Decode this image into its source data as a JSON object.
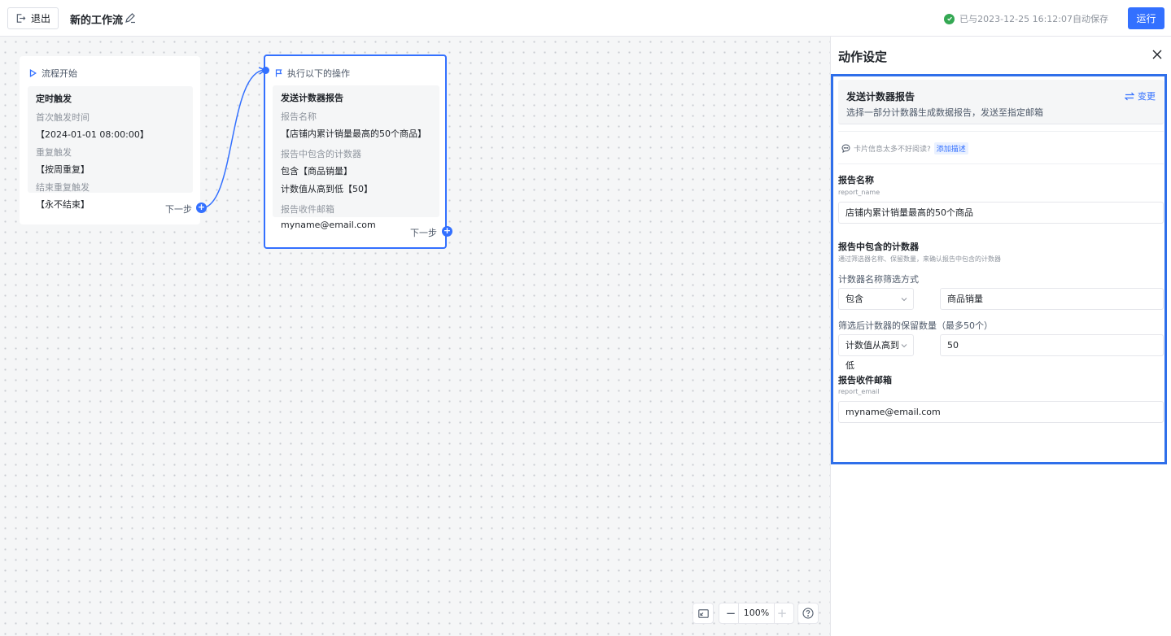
{
  "topbar": {
    "exit_label": "退出",
    "workflow_title": "新的工作流",
    "save_status": "已与2023-12-25 16:12:07自动保存",
    "run_label": "运行"
  },
  "nodes": {
    "start": {
      "header": "流程开始",
      "trigger_title": "定时触发",
      "first_time_label": "首次触发时间",
      "first_time_value": "【2024-01-01 08:00:00】",
      "repeat_label": "重复触发",
      "repeat_value": "【按周重复】",
      "end_label": "结束重复触发",
      "end_value": "【永不结束】",
      "next_label": "下一步"
    },
    "action": {
      "header": "执行以下的操作",
      "title": "发送计数器报告",
      "report_name_label": "报告名称",
      "report_name_value": "【店铺内累计销量最高的50个商品】",
      "counters_label": "报告中包含的计数器",
      "counters_value_1": "包含【商品销量】",
      "counters_value_2": "计数值从高到低【50】",
      "email_label": "报告收件邮箱",
      "email_value": "myname@email.com",
      "next_label": "下一步"
    }
  },
  "canvas_controls": {
    "zoom": "100%",
    "zoom_out": "−",
    "zoom_in": "+"
  },
  "panel": {
    "title": "动作设定",
    "summary_title": "发送计数器报告",
    "summary_desc": "选择一部分计数器生成数据报告，发送至指定邮箱",
    "change_label": "变更",
    "hint_text": "卡片信息太多不好阅读?",
    "hint_link": "添加描述",
    "report_name_label": "报告名称",
    "report_name_key": "report_name",
    "report_name_value": "店铺内累计销量最高的50个商品",
    "counters_label": "报告中包含的计数器",
    "counters_desc": "通过筛选器名称、保留数量，来确认报告中包含的计数器",
    "filter_label": "计数器名称筛选方式",
    "filter_select": "包含",
    "filter_value": "商品销量",
    "keep_label": "筛选后计数器的保留数量（最多50个）",
    "keep_select": "计数值从高到低",
    "keep_value": "50",
    "email_label": "报告收件邮箱",
    "email_key": "report_email",
    "email_value": "myname@email.com"
  },
  "colors": {
    "accent": "#3370ff",
    "highlight_border": "#2f6fea",
    "success": "#34a853"
  },
  "icons": [
    "exit-icon",
    "edit-icon",
    "check-circle-icon",
    "play-icon",
    "flag-icon",
    "plus-icon",
    "fit-view-icon",
    "help-icon",
    "close-icon",
    "swap-icon",
    "comment-icon",
    "chevron-down-icon"
  ]
}
